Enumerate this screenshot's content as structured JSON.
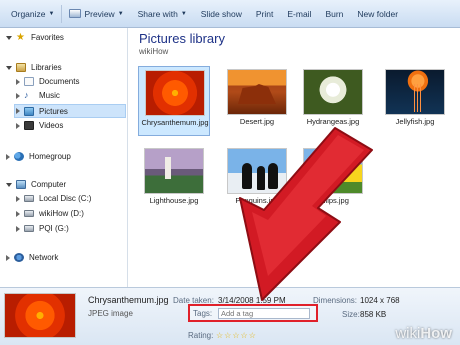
{
  "toolbar": {
    "organize": "Organize",
    "preview": "Preview",
    "share_with": "Share with",
    "slide_show": "Slide show",
    "print": "Print",
    "email": "E-mail",
    "burn": "Burn",
    "new_folder": "New folder"
  },
  "sidebar": {
    "favorites": "Favorites",
    "libraries": "Libraries",
    "documents": "Documents",
    "music": "Music",
    "pictures": "Pictures",
    "videos": "Videos",
    "homegroup": "Homegroup",
    "computer": "Computer",
    "local_disc": "Local Disc (C:)",
    "wikihow_drive": "wikiHow (D:)",
    "pqi_drive": "PQI (G:)",
    "network": "Network"
  },
  "library": {
    "title": "Pictures library",
    "subtitle": "wikiHow"
  },
  "files": [
    {
      "name": "Chrysanthemum.jpg"
    },
    {
      "name": "Desert.jpg"
    },
    {
      "name": "Hydrangeas.jpg"
    },
    {
      "name": "Jellyfish.jpg"
    },
    {
      "name": "Lighthouse.jpg"
    },
    {
      "name": "Penguins.jpg"
    },
    {
      "name": "Tulips.jpg"
    }
  ],
  "details": {
    "file_name": "Chrysanthemum.jpg",
    "file_type": "JPEG image",
    "date_taken_label": "Date taken:",
    "date_taken_value": "3/14/2008 1:59 PM",
    "tags_label": "Tags:",
    "tags_placeholder": "Add a tag",
    "rating_label": "Rating:",
    "dimensions_label": "Dimensions:",
    "dimensions_value": "1024 x 768",
    "size_label": "Size:",
    "size_value": "858 KB",
    "rating_stars": 0
  },
  "watermark": {
    "wiki": "wiki",
    "how": "How"
  },
  "colors": {
    "annotation": "#e0202a",
    "title": "#1e3287",
    "selection": "#cce8ff"
  }
}
